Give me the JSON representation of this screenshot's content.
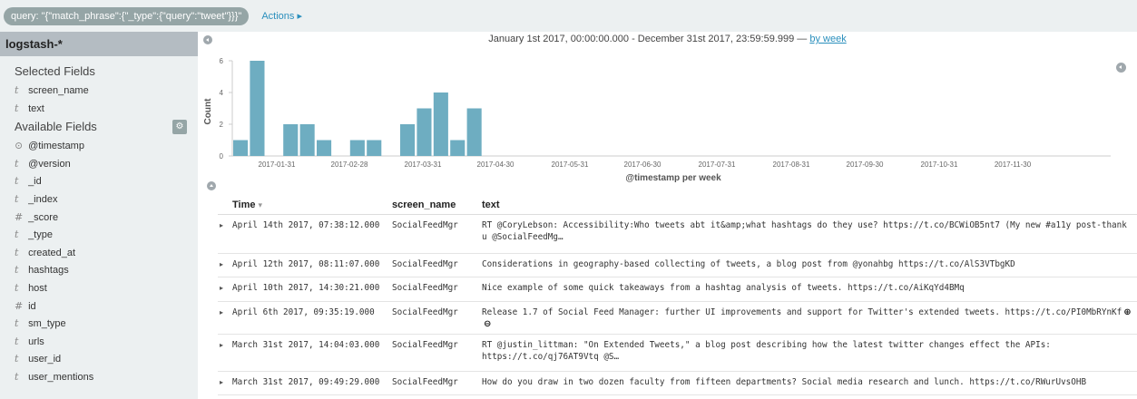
{
  "topbar": {
    "query": "query: \"{\"match_phrase\":{\"_type\":{\"query\":\"tweet\"}}}\"",
    "actions_label": "Actions ▸"
  },
  "sidebar": {
    "index_pattern": "logstash-*",
    "selected_title": "Selected Fields",
    "selected_fields": [
      {
        "type_icon": "t",
        "name": "screen_name"
      },
      {
        "type_icon": "t",
        "name": "text"
      }
    ],
    "available_title": "Available Fields",
    "gear_icon": "gear-icon",
    "available_fields": [
      {
        "type_icon": "⊙",
        "name": "@timestamp"
      },
      {
        "type_icon": "t",
        "name": "@version"
      },
      {
        "type_icon": "t",
        "name": "_id"
      },
      {
        "type_icon": "t",
        "name": "_index"
      },
      {
        "type_icon": "#",
        "name": "_score"
      },
      {
        "type_icon": "t",
        "name": "_type"
      },
      {
        "type_icon": "t",
        "name": "created_at"
      },
      {
        "type_icon": "t",
        "name": "hashtags"
      },
      {
        "type_icon": "t",
        "name": "host"
      },
      {
        "type_icon": "#",
        "name": "id"
      },
      {
        "type_icon": "t",
        "name": "sm_type"
      },
      {
        "type_icon": "t",
        "name": "urls"
      },
      {
        "type_icon": "t",
        "name": "user_id"
      },
      {
        "type_icon": "t",
        "name": "user_mentions"
      }
    ]
  },
  "main": {
    "time_range": "January 1st 2017, 00:00:00.000 - December 31st 2017, 23:59:59.999 — ",
    "interval_link": "by week"
  },
  "chart_data": {
    "type": "bar",
    "bar_color": "#6eadc1",
    "xlabel": "@timestamp per week",
    "ylabel": "Count",
    "ylim": [
      0,
      6
    ],
    "y_ticks": [
      "0",
      "2",
      "4",
      "6"
    ],
    "x_ticks": [
      "2017-01-31",
      "2017-02-28",
      "2017-03-31",
      "2017-04-30",
      "2017-05-31",
      "2017-06-30",
      "2017-07-31",
      "2017-08-31",
      "2017-09-30",
      "2017-10-31",
      "2017-11-30"
    ],
    "week_index_start": 0,
    "values": [
      1,
      6,
      0,
      2,
      2,
      1,
      0,
      1,
      1,
      0,
      2,
      3,
      4,
      1,
      3
    ],
    "grid": false
  },
  "table": {
    "columns": [
      "Time",
      "screen_name",
      "text"
    ],
    "sort_caret": "▾",
    "rows": [
      {
        "time": "April 14th 2017, 07:38:12.000",
        "screen_name": "SocialFeedMgr",
        "text": "RT @CoryLebson: Accessibility:Who tweets abt it&amp;what hashtags do they use? https://t.co/BCWiOB5nt7 (My new #a11y post-thank u @SocialFeedMg…"
      },
      {
        "time": "April 12th 2017, 08:11:07.000",
        "screen_name": "SocialFeedMgr",
        "text": "Considerations in geography-based collecting of tweets, a blog post from @yonahbg https://t.co/AlS3VTbgKD"
      },
      {
        "time": "April 10th 2017, 14:30:21.000",
        "screen_name": "SocialFeedMgr",
        "text": "Nice example of some quick takeaways from a hashtag analysis of tweets. https://t.co/AiKqYd4BMq"
      },
      {
        "time": "April 6th 2017, 09:35:19.000",
        "screen_name": "SocialFeedMgr",
        "text": "Release 1.7 of Social Feed Manager: further UI improvements and support for Twitter's extended tweets. https://t.co/PI0MbRYnKf"
      },
      {
        "time": "March 31st 2017, 14:04:03.000",
        "screen_name": "SocialFeedMgr",
        "text": "RT @justin_littman: \"On Extended Tweets,\" a blog post describing how the latest twitter changes effect the APIs: https://t.co/qj76AT9Vtq @S…"
      },
      {
        "time": "March 31st 2017, 09:49:29.000",
        "screen_name": "SocialFeedMgr",
        "text": "How do you draw in two dozen faculty from fifteen departments? Social media research and lunch. https://t.co/RWurUvsOHB"
      }
    ],
    "expander": "▸",
    "magnify_icons": [
      "zoom-in-icon",
      "zoom-out-icon"
    ]
  }
}
